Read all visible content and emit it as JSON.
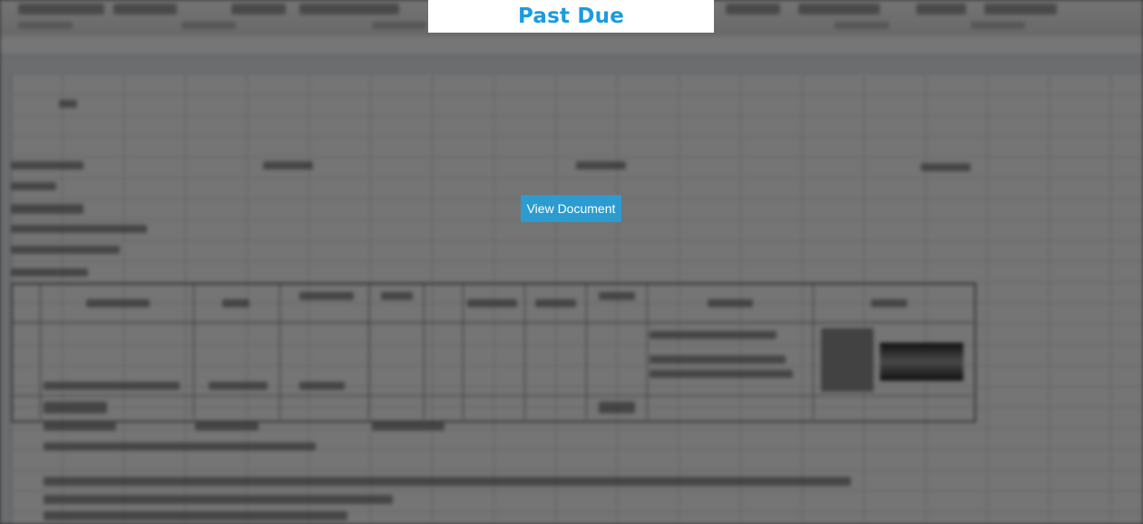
{
  "banner": {
    "title": "Past Due"
  },
  "view_button": {
    "label": "View Document"
  },
  "colors": {
    "banner_text": "#1a9be0",
    "button_bg": "#2b9bd0",
    "button_text": "#ffffff",
    "overlay": "rgba(0,0,0,0.52)"
  }
}
